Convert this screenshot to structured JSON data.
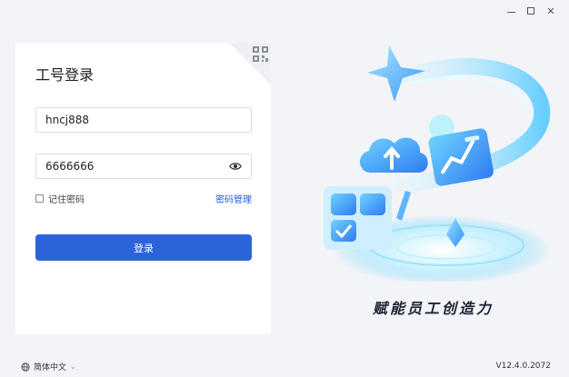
{
  "window": {
    "minimize_icon": "minimize-icon",
    "maximize_icon": "maximize-icon",
    "close_icon": "close-icon"
  },
  "login": {
    "title": "工号登录",
    "username": "hncj888",
    "password": "6666666",
    "remember_label": "记住密码",
    "manage_password_label": "密码管理",
    "submit_label": "登录",
    "remember_checked": false,
    "qr_icon": "qr-code-icon",
    "eye_icon": "eye-icon"
  },
  "hero": {
    "slogan": "赋能员工创造力"
  },
  "footer": {
    "language": "简体中文",
    "version": "V12.4.0.2072"
  },
  "colors": {
    "accent": "#2b63d9",
    "link": "#2463d6",
    "background": "#f2f4f8"
  }
}
